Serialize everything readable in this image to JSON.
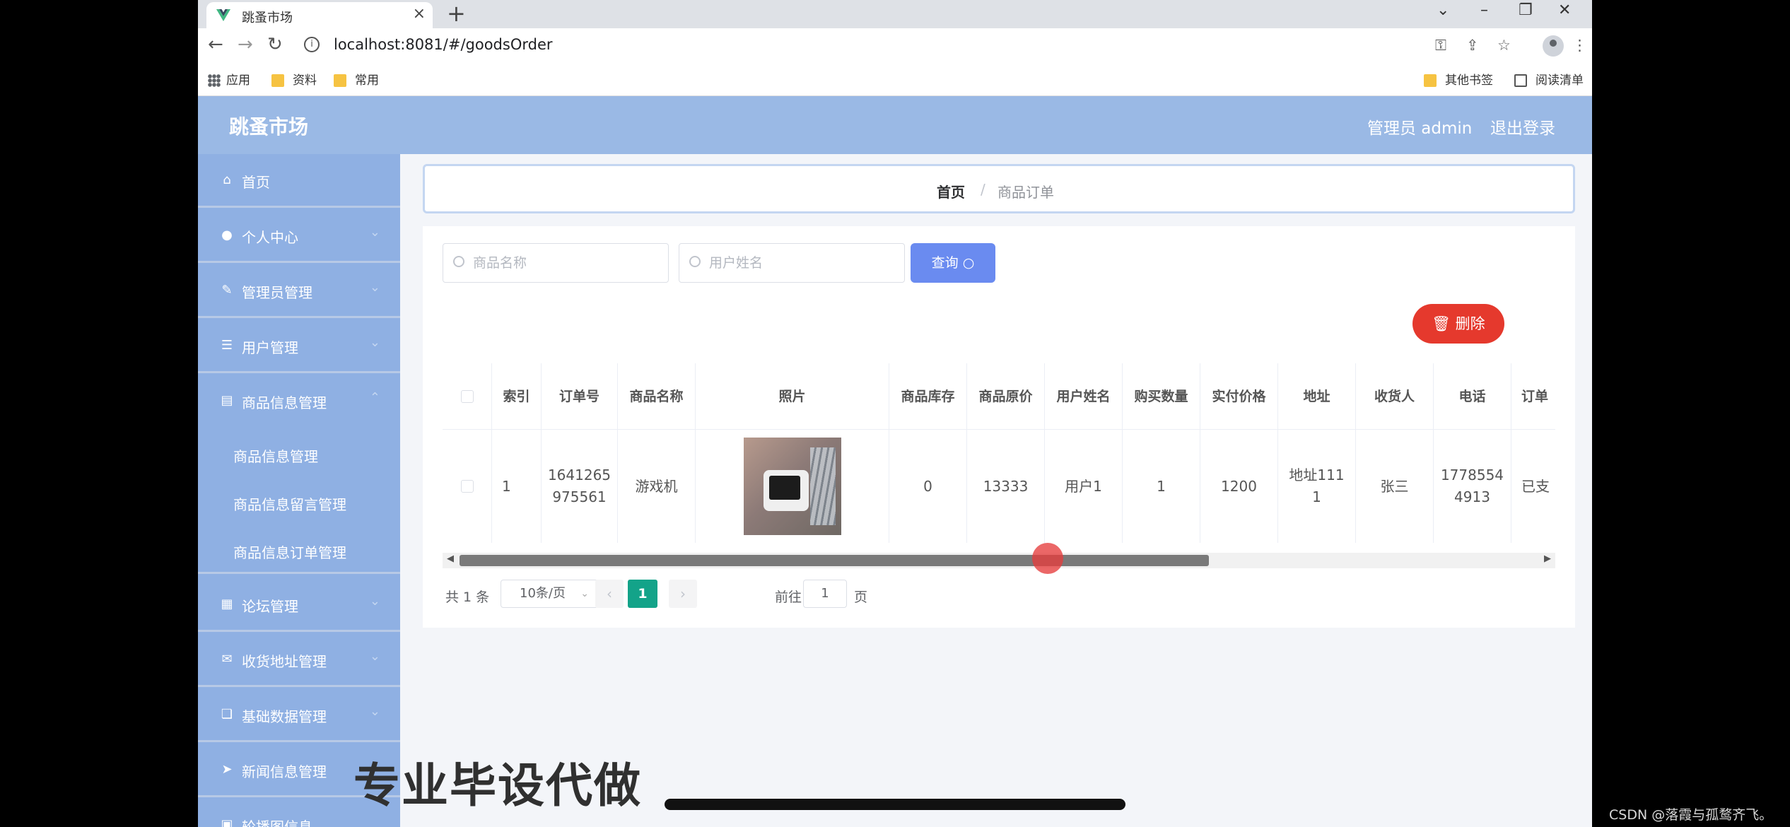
{
  "browser": {
    "tab_title": "跳蚤市场",
    "url": "localhost:8081/#/goodsOrder",
    "bookmarks": [
      "应用",
      "资料",
      "常用"
    ],
    "bookmarks_right": [
      "其他书签",
      "阅读清单"
    ]
  },
  "header": {
    "title": "跳蚤市场",
    "admin": "管理员 admin",
    "logout": "退出登录"
  },
  "sidebar": {
    "items": [
      {
        "label": "首页",
        "icon": "home-icon"
      },
      {
        "label": "个人中心",
        "icon": "user-icon"
      },
      {
        "label": "管理员管理",
        "icon": "edit-icon"
      },
      {
        "label": "用户管理",
        "icon": "list-icon"
      },
      {
        "label": "商品信息管理",
        "icon": "clipboard-icon"
      }
    ],
    "sub_items": [
      "商品信息管理",
      "商品信息留言管理",
      "商品信息订单管理"
    ],
    "items_after": [
      {
        "label": "论坛管理",
        "icon": "forum-icon"
      },
      {
        "label": "收货地址管理",
        "icon": "address-icon"
      },
      {
        "label": "基础数据管理",
        "icon": "data-icon"
      },
      {
        "label": "新闻信息管理",
        "icon": "news-icon"
      },
      {
        "label": "轮播图信息",
        "icon": "carousel-icon"
      }
    ]
  },
  "breadcrumb": {
    "home": "首页",
    "sep": "/",
    "current": "商品订单"
  },
  "search": {
    "goods_placeholder": "商品名称",
    "user_placeholder": "用户姓名",
    "query_label": "查询"
  },
  "actions": {
    "delete_label": "删除"
  },
  "table": {
    "headers": [
      "索引",
      "订单号",
      "商品名称",
      "照片",
      "商品库存",
      "商品原价",
      "用户姓名",
      "购买数量",
      "实付价格",
      "地址",
      "收货人",
      "电话",
      "订单"
    ],
    "rows": [
      {
        "index": "1",
        "order_no": "1641265\n975561",
        "goods_name": "游戏机",
        "stock": "0",
        "original_price": "13333",
        "user_name": "用户1",
        "quantity": "1",
        "paid_price": "1200",
        "address": "地址111\n1",
        "receiver": "张三",
        "phone": "1778554\n4913",
        "status": "已支"
      }
    ]
  },
  "pagination": {
    "total": "共 1 条",
    "page_size": "10条/页",
    "current_page": "1",
    "goto_prefix": "前往",
    "goto_value": "1",
    "goto_suffix": "页"
  },
  "overlay": {
    "watermark": "专业毕设代做",
    "credit": "CSDN @落霞与孤鹜齐飞。"
  },
  "colors": {
    "header": "#9ab9e5",
    "sidebar": "#8fb0e3",
    "query_button": "#6a8bf0",
    "delete_button": "#e5392d",
    "active_page": "#13a389"
  }
}
